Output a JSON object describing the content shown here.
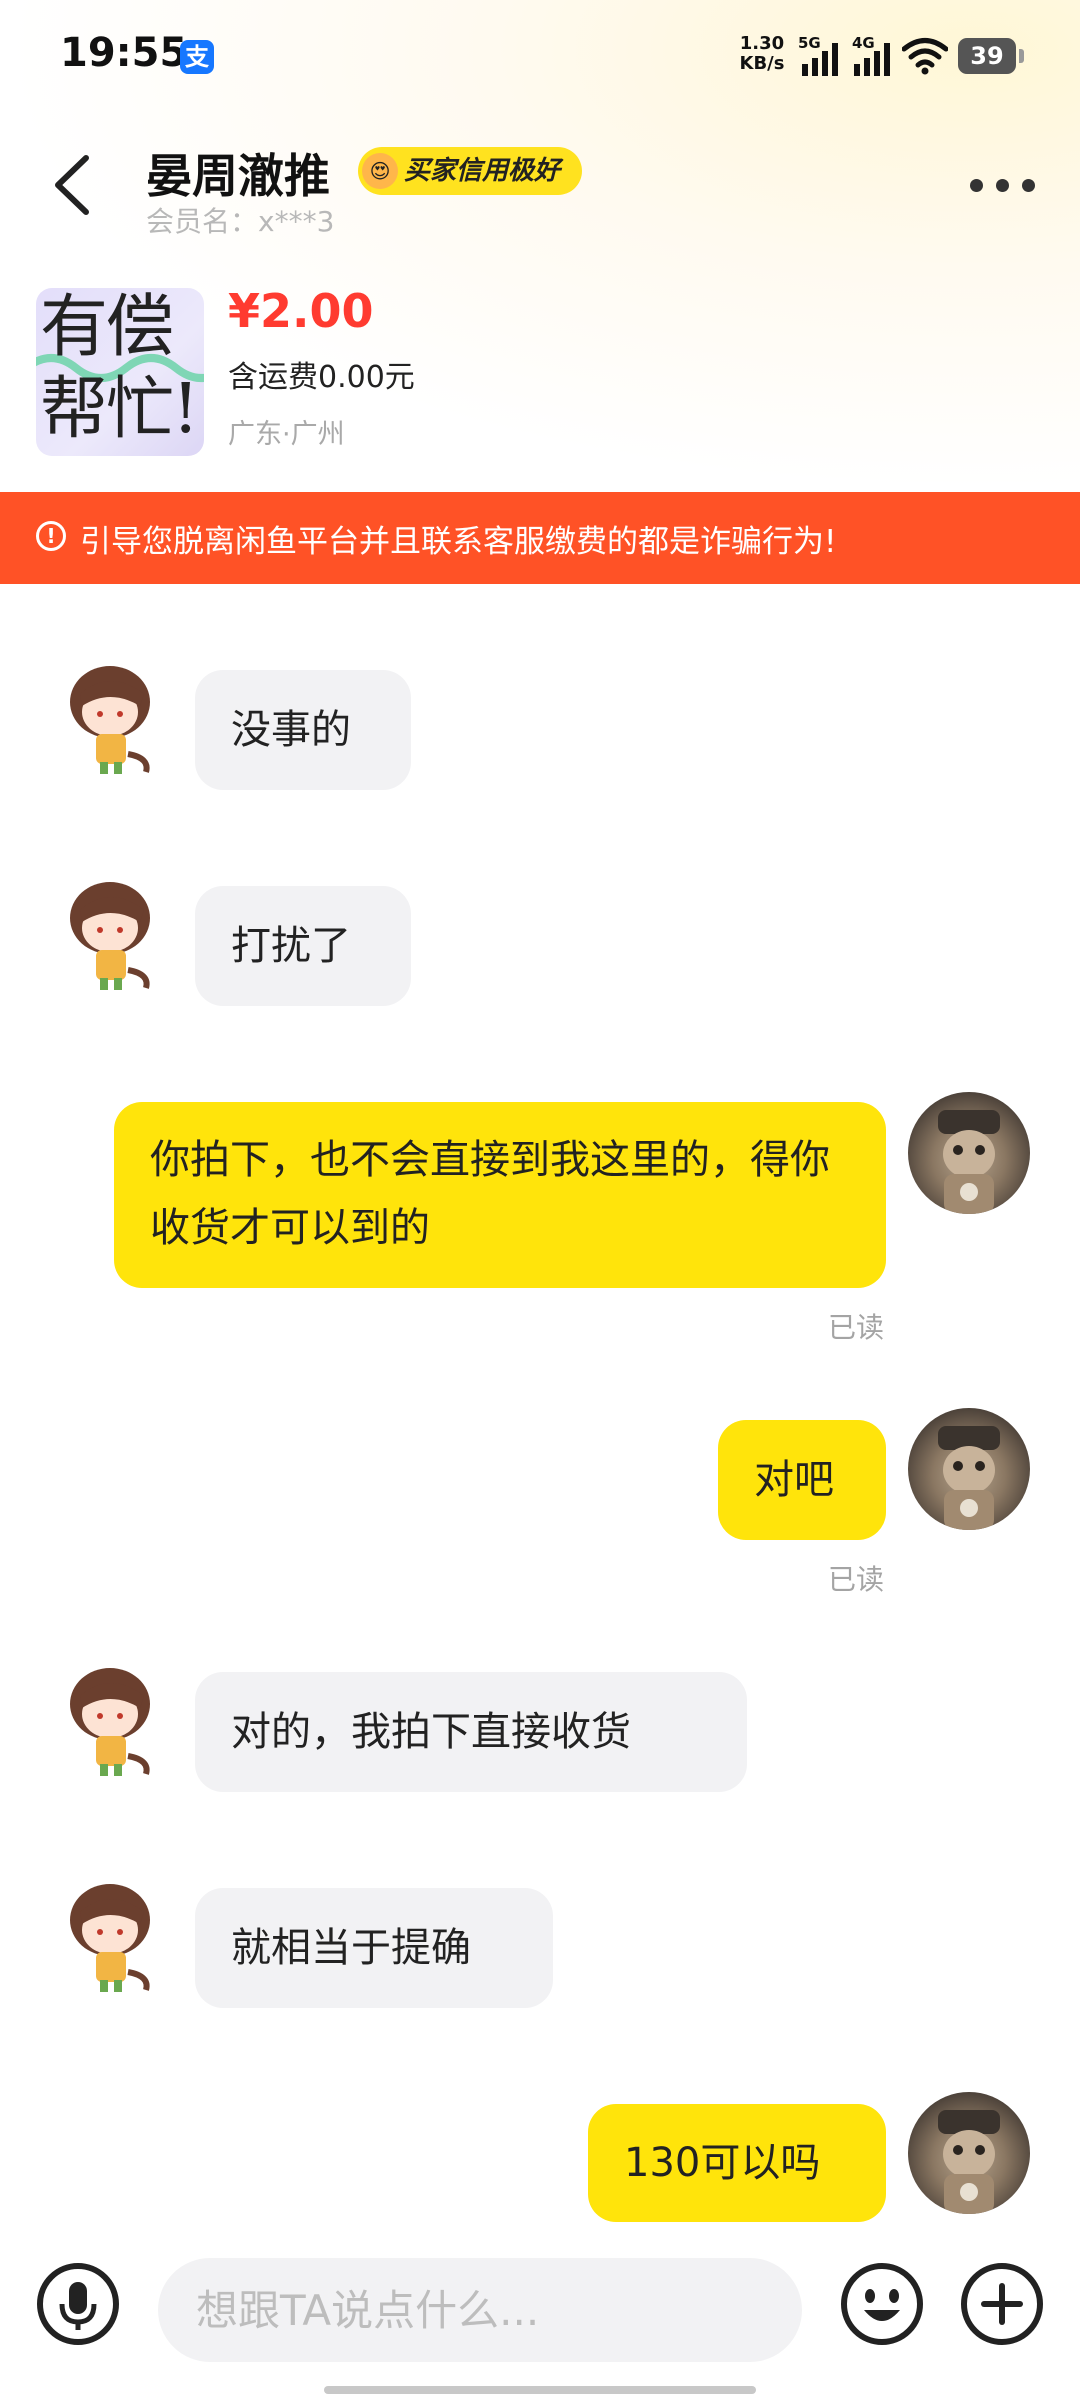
{
  "status_bar": {
    "time": "19:55",
    "app_badge": "支",
    "net_speed_value": "1.30",
    "net_speed_unit": "KB/s",
    "signal_1_label": "5G",
    "signal_2_label": "4G",
    "battery": "39"
  },
  "header": {
    "seller_name": "晏周澈推",
    "credit_badge": "买家信用极好",
    "member_name": "会员名：x***3"
  },
  "product": {
    "thumb_line1": "有偿",
    "thumb_line2": "帮忙!",
    "price": "¥2.00",
    "shipping": "含运费0.00元",
    "location": "广东·广州"
  },
  "warning": {
    "text": "引导您脱离闲鱼平台并且联系客服缴费的都是诈骗行为!"
  },
  "messages": [
    {
      "side": "in",
      "text": "没事的"
    },
    {
      "side": "in",
      "text": "打扰了"
    },
    {
      "side": "out",
      "text": "你拍下，也不会直接到我这里的，得你收货才可以到的",
      "status": "已读"
    },
    {
      "side": "out",
      "text": "对吧",
      "status": "已读"
    },
    {
      "side": "in",
      "text": "对的，我拍下直接收货"
    },
    {
      "side": "in",
      "text": "就相当于提确"
    },
    {
      "side": "out",
      "text": "130可以吗"
    }
  ],
  "input": {
    "placeholder": "想跟TA说点什么..."
  },
  "colors": {
    "accent_yellow": "#ffe40b",
    "warning_orange": "#ff5226",
    "price_red": "#ff3b30"
  },
  "icons": [
    "back-arrow-icon",
    "more-dots-icon",
    "microphone-icon",
    "emoji-icon",
    "plus-icon",
    "warning-icon",
    "wifi-icon",
    "signal-icon",
    "battery-icon"
  ]
}
